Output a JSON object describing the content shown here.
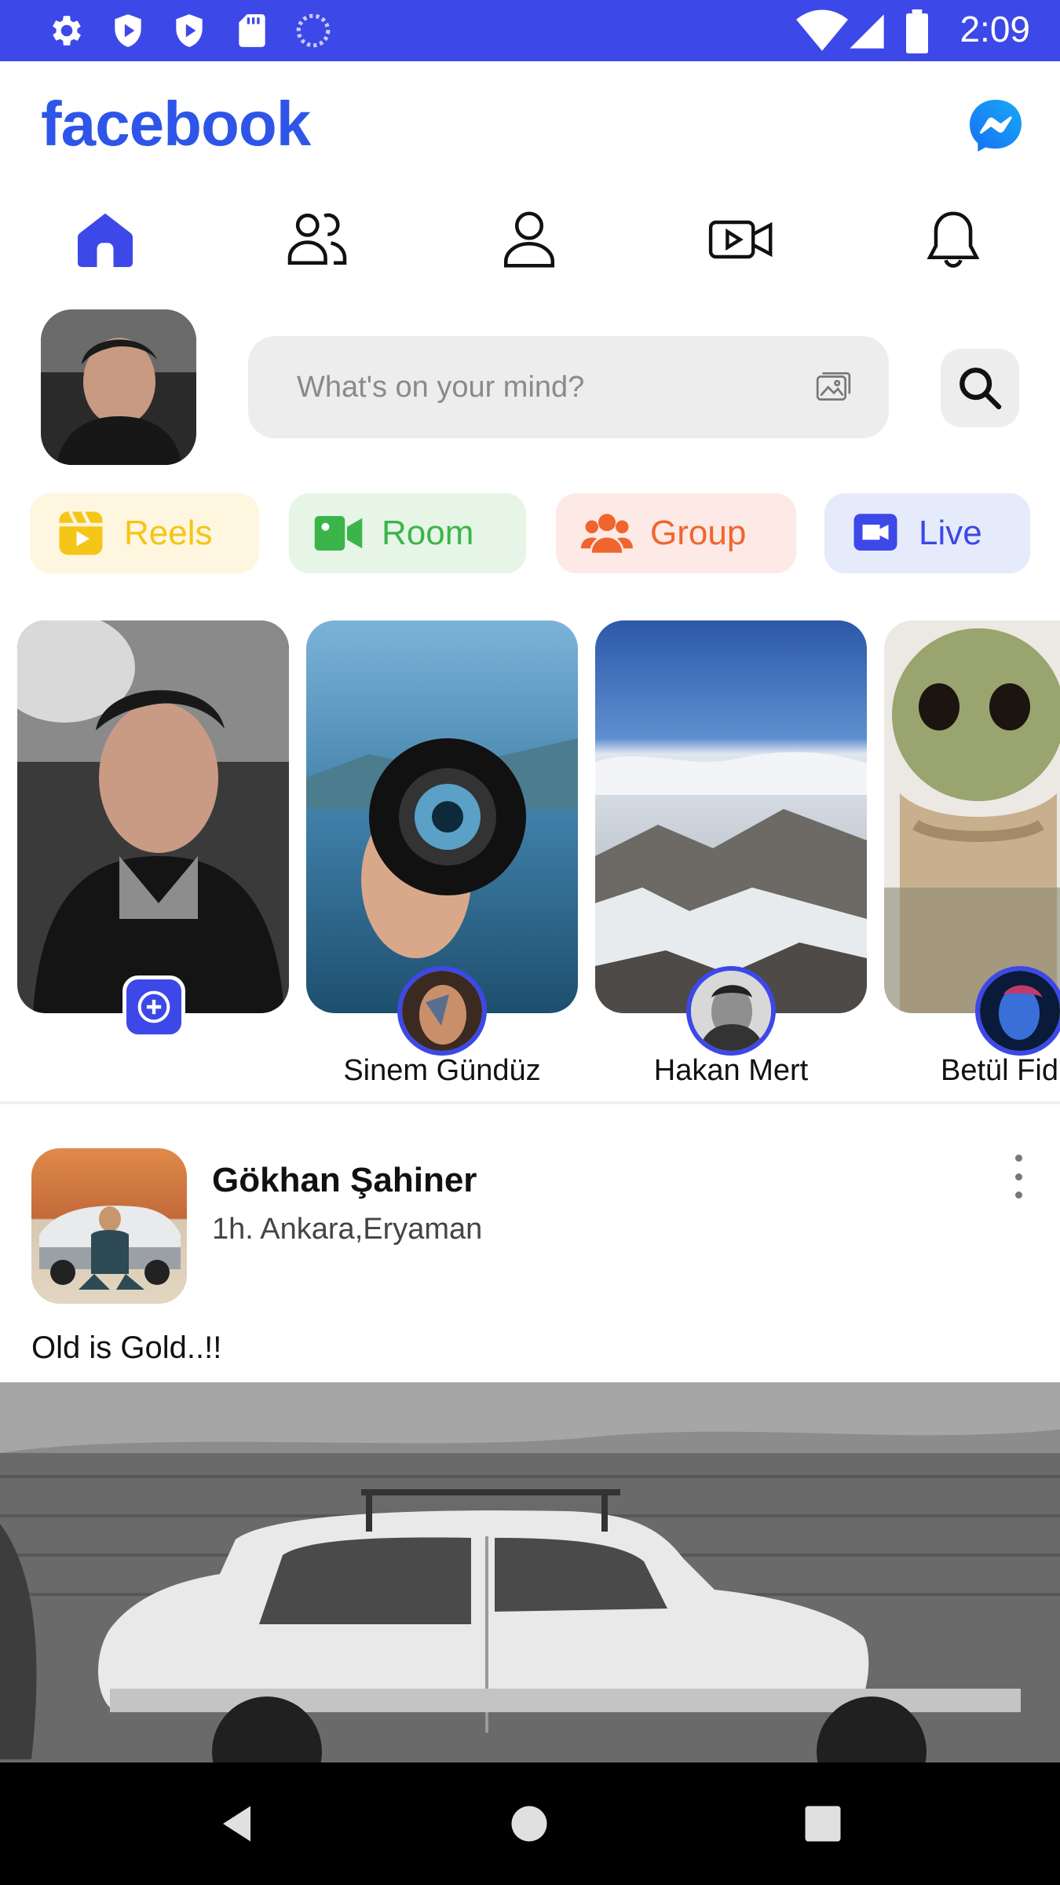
{
  "status_bar": {
    "time": "2:09",
    "icons": [
      "settings-icon",
      "shield-play-icon",
      "shield-play-icon",
      "sd-card-icon",
      "sync-icon",
      "wifi-icon",
      "signal-icon",
      "battery-icon"
    ],
    "background": "#3d48e8"
  },
  "header": {
    "logo": "facebook",
    "logo_color": "#2e55e8",
    "messenger_icon": "messenger-icon"
  },
  "nav_tabs": [
    {
      "name": "home",
      "icon": "home-icon",
      "active": true
    },
    {
      "name": "friends",
      "icon": "friends-icon",
      "active": false
    },
    {
      "name": "profile",
      "icon": "profile-icon",
      "active": false
    },
    {
      "name": "watch",
      "icon": "video-icon",
      "active": false
    },
    {
      "name": "notifications",
      "icon": "bell-icon",
      "active": false
    }
  ],
  "composer": {
    "placeholder": "What's on your mind?",
    "photo_icon": "photo-icon",
    "search_icon": "search-icon"
  },
  "chips": [
    {
      "label": "Reels",
      "color": "#f5c518",
      "bg": "#fff6df"
    },
    {
      "label": "Room",
      "color": "#3bb54a",
      "bg": "#e6f5e6"
    },
    {
      "label": "Group",
      "color": "#f0652d",
      "bg": "#fde9e6"
    },
    {
      "label": "Live",
      "color": "#3d48e8",
      "bg": "#e6ebfb"
    }
  ],
  "stories": [
    {
      "name": "",
      "own": true
    },
    {
      "name": "Sinem Gündüz"
    },
    {
      "name": "Hakan Mert"
    },
    {
      "name": "Betül Fid"
    }
  ],
  "post": {
    "author": "Gökhan Şahiner",
    "meta": "1h. Ankara,Eryaman",
    "text": "Old is Gold..!!"
  },
  "system_nav": [
    "back-icon",
    "home-circle-icon",
    "recents-icon"
  ]
}
